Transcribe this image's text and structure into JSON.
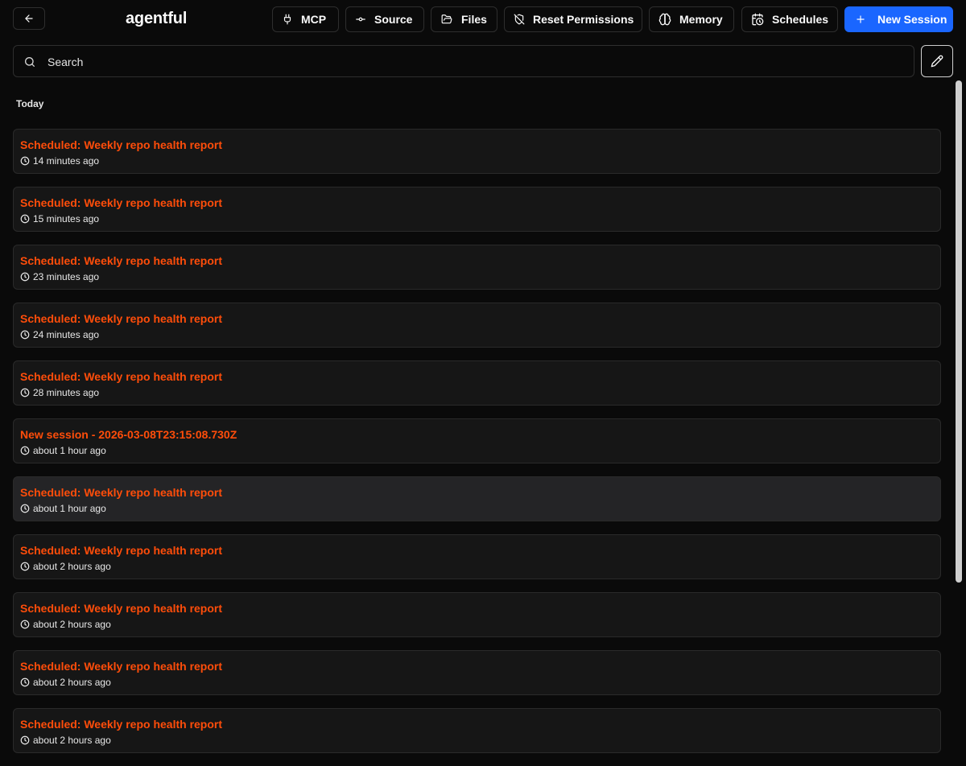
{
  "header": {
    "app_title": "agentful",
    "buttons": {
      "mcp": "MCP",
      "source": "Source",
      "files": "Files",
      "reset_permissions": "Reset Permissions",
      "memory": "Memory",
      "schedules": "Schedules",
      "new_session": "New Session"
    }
  },
  "search": {
    "placeholder": "Search",
    "value": ""
  },
  "sections": [
    {
      "label": "Today",
      "sessions": [
        {
          "title": "Scheduled: Weekly repo health report",
          "time": "14 minutes ago"
        },
        {
          "title": "Scheduled: Weekly repo health report",
          "time": "15 minutes ago"
        },
        {
          "title": "Scheduled: Weekly repo health report",
          "time": "23 minutes ago"
        },
        {
          "title": "Scheduled: Weekly repo health report",
          "time": "24 minutes ago"
        },
        {
          "title": "Scheduled: Weekly repo health report",
          "time": "28 minutes ago"
        },
        {
          "title": "New session - 2026-03-08T23:15:08.730Z",
          "time": "about 1 hour ago"
        },
        {
          "title": "Scheduled: Weekly repo health report",
          "time": "about 1 hour ago"
        },
        {
          "title": "Scheduled: Weekly repo health report",
          "time": "about 2 hours ago"
        },
        {
          "title": "Scheduled: Weekly repo health report",
          "time": "about 2 hours ago"
        },
        {
          "title": "Scheduled: Weekly repo health report",
          "time": "about 2 hours ago"
        },
        {
          "title": "Scheduled: Weekly repo health report",
          "time": "about 2 hours ago"
        }
      ]
    }
  ],
  "colors": {
    "accent": "#1a66ff",
    "session_title": "#ff4d0a",
    "background": "#0a0a0a"
  }
}
